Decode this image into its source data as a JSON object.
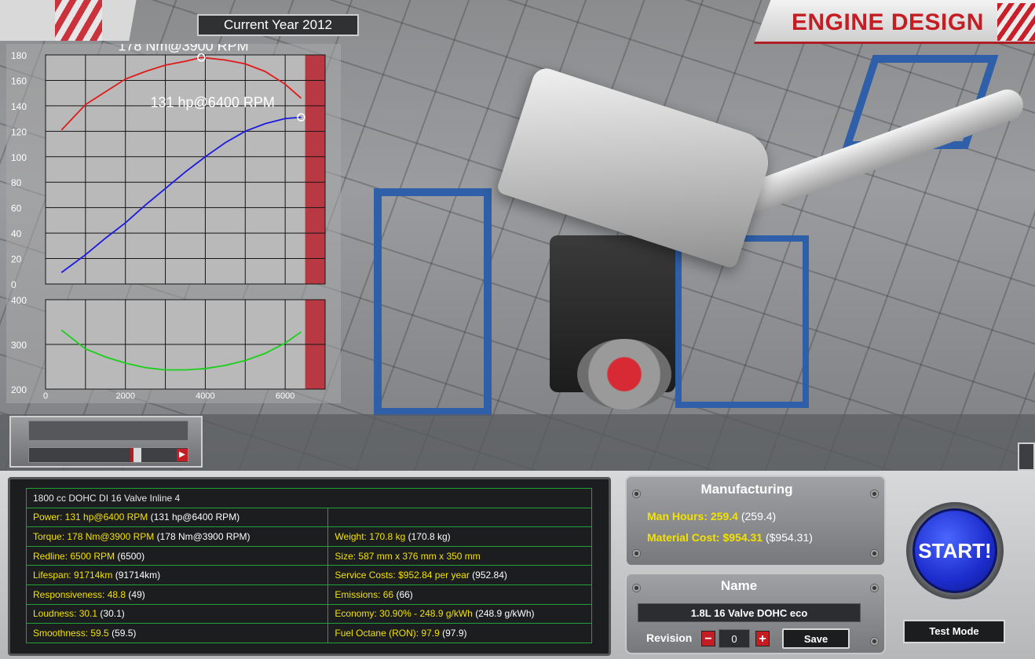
{
  "header": {
    "current_year": "Current Year 2012",
    "title": "ENGINE DESIGN"
  },
  "chart_data": [
    {
      "type": "line",
      "title": "",
      "xlabel": "",
      "ylabel": "",
      "xlim": [
        0,
        7000
      ],
      "ylim": [
        0,
        180
      ],
      "y_ticks": [
        "180",
        "160",
        "140",
        "120",
        "100",
        "80",
        "60",
        "40",
        "20",
        "0"
      ],
      "redline_from": 6500,
      "series": [
        {
          "color": "#e01a1a",
          "x": [
            400,
            1000,
            1500,
            2000,
            2500,
            3000,
            3500,
            3900,
            4500,
            5000,
            5500,
            6000,
            6400
          ],
          "y": [
            121,
            141,
            151,
            161,
            167,
            172,
            175,
            178,
            176,
            173,
            167,
            157,
            146
          ]
        },
        {
          "color": "#1a1ae0",
          "x": [
            400,
            1000,
            1500,
            2000,
            2500,
            3000,
            3500,
            4000,
            4500,
            5000,
            5500,
            6000,
            6400
          ],
          "y": [
            9,
            23,
            36,
            48,
            62,
            75,
            88,
            100,
            111,
            120,
            126,
            130,
            131
          ]
        }
      ],
      "annotations": [
        {
          "text": "178 Nm@3900 RPM",
          "x": 3900,
          "y": 178
        },
        {
          "text": "131 hp@6400 RPM",
          "x": 6400,
          "y": 131
        }
      ]
    },
    {
      "type": "line",
      "title": "",
      "xlabel": "",
      "ylabel": "",
      "xlim": [
        0,
        7000
      ],
      "ylim": [
        200,
        400
      ],
      "y_ticks": [
        "400",
        "300",
        "200"
      ],
      "x_ticks": [
        "0",
        "2000",
        "4000",
        "6000"
      ],
      "redline_from": 6500,
      "series": [
        {
          "color": "#18d018",
          "x": [
            400,
            1000,
            1500,
            2000,
            2500,
            3000,
            3500,
            4000,
            4500,
            5000,
            5500,
            6000,
            6400
          ],
          "y": [
            332,
            290,
            272,
            258,
            248,
            243,
            243,
            246,
            253,
            264,
            280,
            303,
            328
          ]
        }
      ]
    }
  ],
  "stats": {
    "engine_desc": "1800 cc DOHC DI 16 Valve Inline 4",
    "rows": [
      {
        "left": "Power: 131 hp@6400 RPM",
        "left_paren": "(131 hp@6400 RPM)",
        "right": "",
        "right_paren": ""
      },
      {
        "left": "Torque: 178 Nm@3900 RPM",
        "left_paren": "(178 Nm@3900 RPM)",
        "right": "Weight: 170.8 kg",
        "right_paren": "(170.8 kg)"
      },
      {
        "left": "Redline: 6500 RPM",
        "left_paren": "(6500)",
        "right": "Size: 587 mm x 376 mm x 350 mm",
        "right_paren": ""
      },
      {
        "left": "Lifespan: 91714km",
        "left_paren": "(91714km)",
        "right": "Service Costs: $952.84 per year",
        "right_paren": "(952.84)"
      },
      {
        "left": "Responsiveness: 48.8",
        "left_paren": "(49)",
        "right": "Emissions: 66",
        "right_paren": "(66)"
      },
      {
        "left": "Loudness: 30.1",
        "left_paren": "(30.1)",
        "right": "Economy: 30.90% - 248.9 g/kWh",
        "right_paren": "(248.9 g/kWh)"
      },
      {
        "left": "Smoothness: 59.5",
        "left_paren": "(59.5)",
        "right": "Fuel Octane (RON): 97.9",
        "right_paren": "(97.9)"
      }
    ]
  },
  "manufacturing": {
    "title": "Manufacturing",
    "man_hours": "Man Hours: 259.4",
    "man_hours_paren": "(259.4)",
    "material_cost": "Material Cost: $954.31",
    "material_cost_paren": "($954.31)"
  },
  "name_panel": {
    "title": "Name",
    "engine_name": "1.8L 16 Valve DOHC eco",
    "revision_label": "Revision",
    "revision_value": "0",
    "minus": "−",
    "plus": "+",
    "save_label": "Save"
  },
  "actions": {
    "start_label": "START!",
    "test_mode_label": "Test Mode"
  },
  "colors": {
    "accent_red": "#c41e24",
    "stat_yellow": "#f4e200",
    "grid_green": "#22a13a",
    "start_blue": "#1c2ccc"
  }
}
